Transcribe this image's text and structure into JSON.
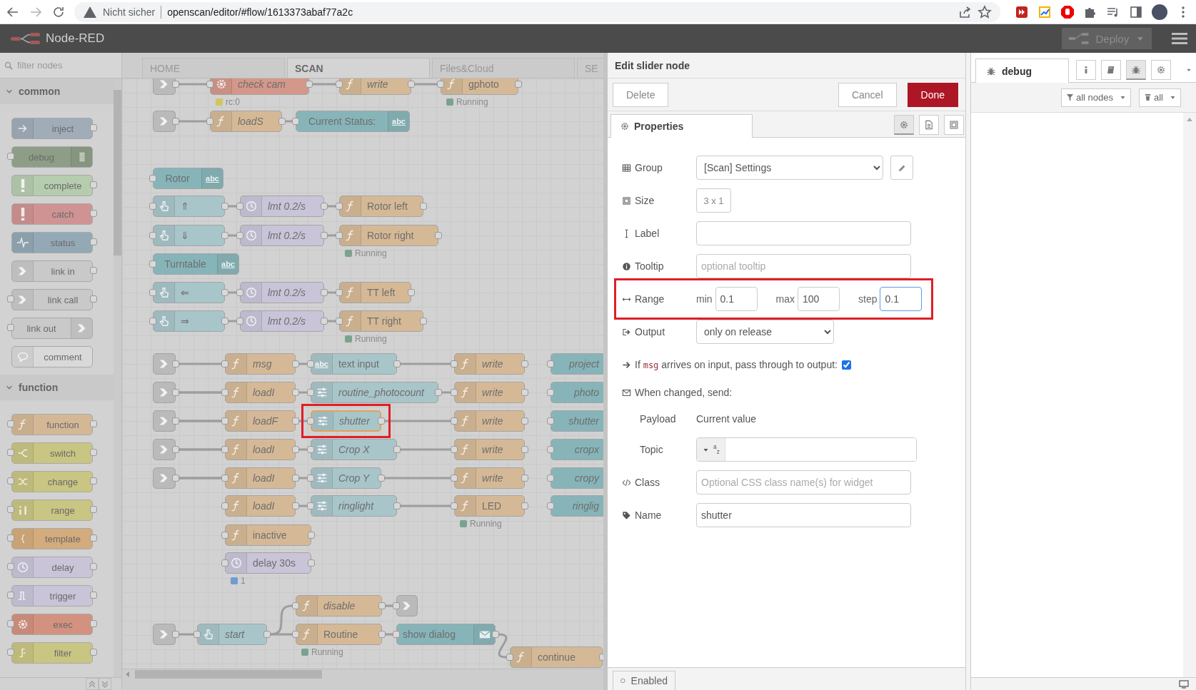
{
  "browser": {
    "security_label": "Nicht sicher",
    "url": "openscan/editor/#flow/1613373abaf77a2c"
  },
  "header": {
    "title": "Node-RED",
    "deploy_label": "Deploy",
    "deploy_disabled": true
  },
  "palette": {
    "filter_placeholder": "filter nodes",
    "categories": [
      {
        "name": "common",
        "expanded": true,
        "nodes": [
          {
            "label": "inject",
            "kind": "inject"
          },
          {
            "label": "debug",
            "kind": "debug"
          },
          {
            "label": "complete",
            "kind": "complete"
          },
          {
            "label": "catch",
            "kind": "catch"
          },
          {
            "label": "status",
            "kind": "status"
          },
          {
            "label": "link in",
            "kind": "link_in"
          },
          {
            "label": "link call",
            "kind": "link_call"
          },
          {
            "label": "link out",
            "kind": "link_out"
          },
          {
            "label": "comment",
            "kind": "comment"
          }
        ]
      },
      {
        "name": "function",
        "expanded": true,
        "nodes": [
          {
            "label": "function",
            "kind": "function"
          },
          {
            "label": "switch",
            "kind": "switch"
          },
          {
            "label": "change",
            "kind": "change"
          },
          {
            "label": "range",
            "kind": "range"
          },
          {
            "label": "template",
            "kind": "template"
          },
          {
            "label": "delay",
            "kind": "delay"
          },
          {
            "label": "trigger",
            "kind": "trigger"
          },
          {
            "label": "exec",
            "kind": "exec"
          },
          {
            "label": "filter",
            "kind": "filter"
          }
        ]
      }
    ]
  },
  "workspace": {
    "tabs": [
      {
        "label": "HOME",
        "selected": false
      },
      {
        "label": "SCAN",
        "selected": true
      },
      {
        "label": "Files&Cloud",
        "selected": false
      },
      {
        "label": "SE",
        "selected": false
      }
    ],
    "nodes": [
      {
        "kind": "link_in",
        "selected": false
      },
      {
        "kind": "exec",
        "label": "check cam",
        "italic": true,
        "selected": false,
        "status": {
          "text": "rc:0",
          "color": "#d3c55d"
        }
      },
      {
        "kind": "function",
        "label": "write",
        "italic": true,
        "selected": false
      },
      {
        "kind": "function",
        "label": "gphoto",
        "italic": false,
        "selected": false,
        "status": {
          "text": "Running",
          "color": "#7aa38f"
        }
      },
      {
        "kind": "link_in",
        "selected": false
      },
      {
        "kind": "function",
        "label": "loadS",
        "italic": true,
        "selected": false
      },
      {
        "kind": "ui_text",
        "label": "Current Status:",
        "badge": "abc",
        "italic": false,
        "selected": false
      },
      {
        "kind": "ui_text",
        "label": "Rotor",
        "badge": "abc",
        "italic": false,
        "selected": false
      },
      {
        "kind": "button",
        "label": "⇑",
        "italic": false,
        "selected": false
      },
      {
        "kind": "delay",
        "label": "lmt 0.2/s",
        "italic": true,
        "selected": false
      },
      {
        "kind": "function",
        "label": "Rotor left",
        "italic": false,
        "selected": false
      },
      {
        "kind": "button",
        "label": "⇓",
        "italic": false,
        "selected": false
      },
      {
        "kind": "delay",
        "label": "lmt 0.2/s",
        "italic": true,
        "selected": false
      },
      {
        "kind": "function",
        "label": "Rotor right",
        "italic": false,
        "selected": false,
        "status": {
          "text": "Running",
          "color": "#7aa38f"
        }
      },
      {
        "kind": "ui_text",
        "label": "Turntable",
        "badge": "abc",
        "italic": false,
        "selected": false
      },
      {
        "kind": "button",
        "label": "⇐",
        "italic": false,
        "selected": false
      },
      {
        "kind": "delay",
        "label": "lmt 0.2/s",
        "italic": true,
        "selected": false
      },
      {
        "kind": "function",
        "label": "TT left",
        "italic": false,
        "selected": false
      },
      {
        "kind": "button",
        "label": "⇒",
        "italic": false,
        "selected": false
      },
      {
        "kind": "delay",
        "label": "lmt 0.2/s",
        "italic": true,
        "selected": false
      },
      {
        "kind": "function",
        "label": "TT right",
        "italic": false,
        "selected": false,
        "status": {
          "text": "Running",
          "color": "#7aa38f"
        }
      },
      {
        "kind": "link_in",
        "selected": false
      },
      {
        "kind": "function",
        "label": "msg",
        "italic": true,
        "selected": false
      },
      {
        "kind": "text_input",
        "label": "text input",
        "badge": "abc",
        "italic": false,
        "selected": false
      },
      {
        "kind": "function",
        "label": "write",
        "italic": true,
        "selected": false
      },
      {
        "kind": "ui_output",
        "label": "project",
        "italic": true,
        "selected": false
      },
      {
        "kind": "link_in",
        "selected": false
      },
      {
        "kind": "function",
        "label": "loadI",
        "italic": true,
        "selected": false
      },
      {
        "kind": "slider",
        "label": "routine_photocount",
        "italic": true,
        "selected": false
      },
      {
        "kind": "function",
        "label": "write",
        "italic": true,
        "selected": false
      },
      {
        "kind": "ui_output",
        "label": "photo",
        "italic": true,
        "selected": false
      },
      {
        "kind": "link_in",
        "selected": false
      },
      {
        "kind": "function",
        "label": "loadF",
        "italic": true,
        "selected": false
      },
      {
        "kind": "slider",
        "label": "shutter",
        "italic": true,
        "selected": true,
        "highlight": true
      },
      {
        "kind": "function",
        "label": "write",
        "italic": true,
        "selected": false
      },
      {
        "kind": "ui_output",
        "label": "shutter",
        "italic": true,
        "selected": false
      },
      {
        "kind": "link_in",
        "selected": false
      },
      {
        "kind": "function",
        "label": "loadI",
        "italic": true,
        "selected": false
      },
      {
        "kind": "slider",
        "label": "Crop X",
        "italic": true,
        "selected": false
      },
      {
        "kind": "function",
        "label": "write",
        "italic": true,
        "selected": false
      },
      {
        "kind": "ui_output",
        "label": "cropx",
        "italic": true,
        "selected": false
      },
      {
        "kind": "link_in",
        "selected": false
      },
      {
        "kind": "function",
        "label": "loadI",
        "italic": true,
        "selected": false
      },
      {
        "kind": "slider",
        "label": "Crop Y",
        "italic": true,
        "selected": false
      },
      {
        "kind": "function",
        "label": "write",
        "italic": true,
        "selected": false
      },
      {
        "kind": "ui_output",
        "label": "cropy",
        "italic": true,
        "selected": false
      },
      {
        "kind": "function",
        "label": "loadI",
        "italic": true,
        "selected": false
      },
      {
        "kind": "slider",
        "label": "ringlight",
        "italic": true,
        "selected": false
      },
      {
        "kind": "function",
        "label": "LED",
        "italic": false,
        "selected": false,
        "status": {
          "text": "Running",
          "color": "#7aa38f"
        }
      },
      {
        "kind": "ui_output",
        "label": "ringlig",
        "italic": true,
        "selected": false
      },
      {
        "kind": "function",
        "label": "inactive",
        "italic": false,
        "selected": false
      },
      {
        "kind": "delay",
        "label": "delay 30s",
        "italic": false,
        "selected": false,
        "status": {
          "text": "1",
          "color": "#6f9bd1"
        }
      },
      {
        "kind": "function",
        "label": "disable",
        "italic": true,
        "selected": false
      },
      {
        "kind": "link_out",
        "selected": false
      },
      {
        "kind": "link_in",
        "selected": false
      },
      {
        "kind": "button",
        "label": "start",
        "italic": true,
        "selected": false
      },
      {
        "kind": "function",
        "label": "Routine",
        "italic": false,
        "selected": false,
        "status": {
          "text": "Running",
          "color": "#7aa38f"
        }
      },
      {
        "kind": "dialog",
        "label": "show dialog",
        "italic": false,
        "selected": false
      },
      {
        "kind": "function",
        "label": "continue",
        "italic": false,
        "selected": false
      }
    ]
  },
  "editor": {
    "title": "Edit slider node",
    "delete_label": "Delete",
    "cancel_label": "Cancel",
    "done_label": "Done",
    "tabs": [
      {
        "label": "Properties",
        "selected": true
      }
    ],
    "tool_tabs": [
      {
        "kind": "properties",
        "selected": true
      },
      {
        "kind": "description",
        "selected": false
      },
      {
        "kind": "appearance",
        "selected": false
      }
    ],
    "rows": [
      {
        "kind": "select",
        "label": "Group",
        "value": "[Scan] Settings",
        "has_edit_button": true
      },
      {
        "kind": "size",
        "label": "Size",
        "value": "3 x 1"
      },
      {
        "kind": "text",
        "label": "Label"
      },
      {
        "kind": "text",
        "label": "Tooltip",
        "placeholder": "optional tooltip"
      },
      {
        "kind": "range",
        "label": "Range",
        "highlight": true,
        "parts": [
          {
            "label": "min",
            "value": "0.1",
            "focused": false
          },
          {
            "label": "max",
            "value": "100",
            "focused": false
          },
          {
            "label": "step",
            "value": "0.1",
            "focused": true
          }
        ]
      },
      {
        "kind": "select_short",
        "label": "Output",
        "value": "only on release"
      },
      {
        "kind": "checkbox",
        "label_start": "If",
        "code": "msg",
        "label_end": "arrives on input, pass through to output:",
        "checked": true
      },
      {
        "kind": "heading",
        "label": "When changed, send:"
      },
      {
        "kind": "static",
        "label": "Payload",
        "value": "Current value"
      },
      {
        "kind": "typed",
        "label": "Topic",
        "type_label": "$^{a}$$_{z}$"
      },
      {
        "kind": "text",
        "label": "Class",
        "placeholder": "Optional CSS class name(s) for widget"
      },
      {
        "kind": "text",
        "label": "Name",
        "value": "shutter"
      }
    ],
    "enabled_label": "Enabled"
  },
  "sidebar": {
    "tabs": [
      {
        "label": "debug",
        "selected": true
      }
    ],
    "tool_buttons": [
      {
        "kind": "info",
        "selected": false
      },
      {
        "kind": "help",
        "selected": false
      },
      {
        "kind": "debug",
        "selected": true
      },
      {
        "kind": "config",
        "selected": false
      }
    ],
    "filter_label": "all nodes",
    "clear_label": "all"
  }
}
